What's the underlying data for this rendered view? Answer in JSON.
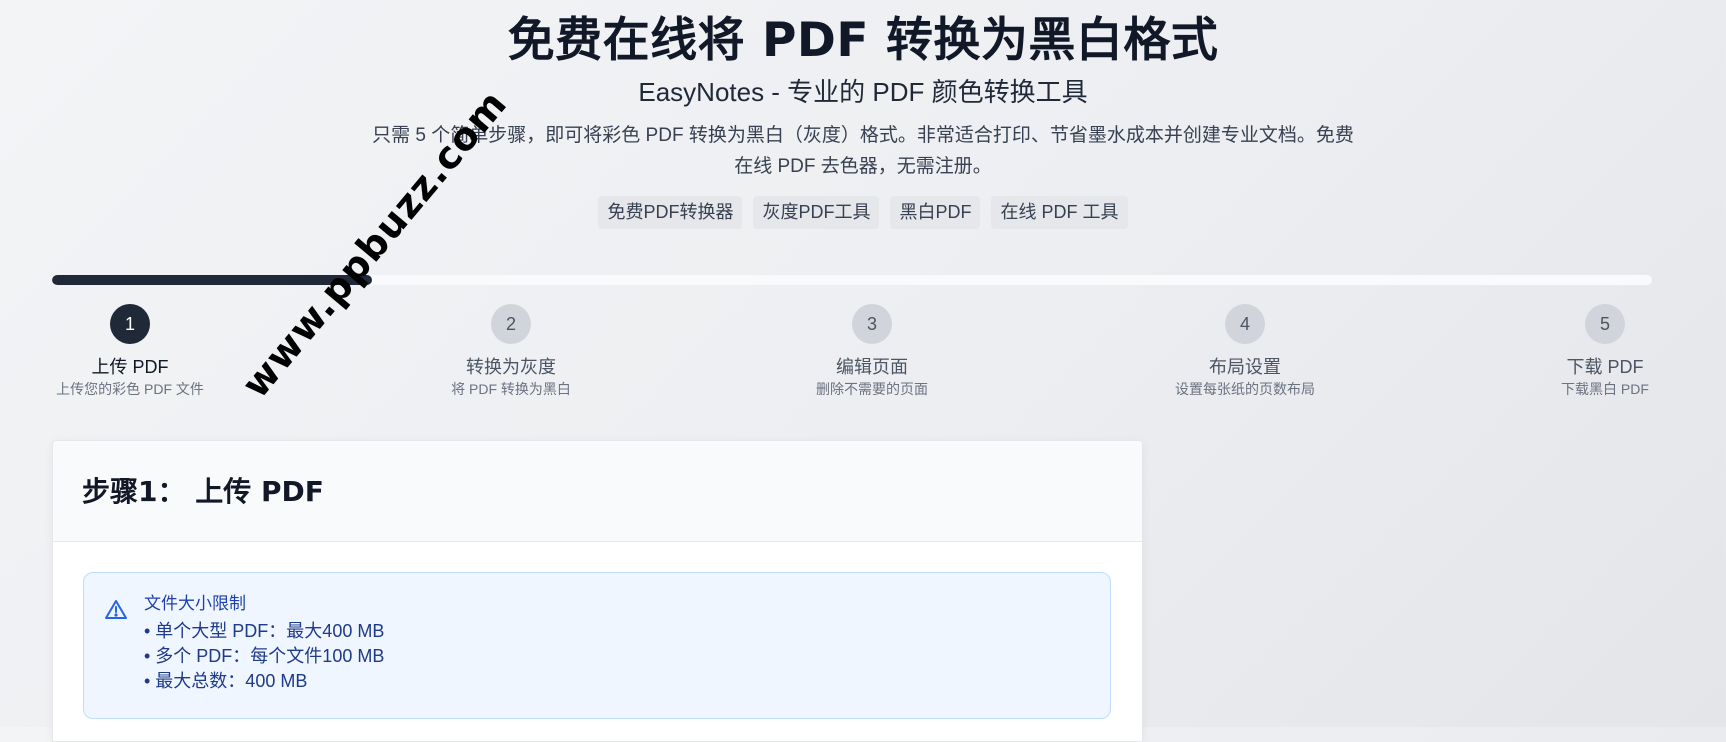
{
  "header": {
    "title": "免费在线将 PDF 转换为黑白格式",
    "subtitle": "EasyNotes - 专业的 PDF 颜色转换工具",
    "description": "只需 5 个简单步骤，即可将彩色 PDF 转换为黑白（灰度）格式。非常适合打印、节省墨水成本并创建专业文档。免费在线 PDF 去色器，无需注册。",
    "tags": [
      "免费PDF转换器",
      "灰度PDF工具",
      "黑白PDF",
      "在线 PDF 工具"
    ]
  },
  "progress": {
    "percent": 20
  },
  "steps": [
    {
      "number": "1",
      "title": "上传 PDF",
      "desc": "上传您的彩色 PDF 文件",
      "active": true
    },
    {
      "number": "2",
      "title": "转换为灰度",
      "desc": "将 PDF 转换为黑白",
      "active": false
    },
    {
      "number": "3",
      "title": "编辑页面",
      "desc": "删除不需要的页面",
      "active": false
    },
    {
      "number": "4",
      "title": "布局设置",
      "desc": "设置每张纸的页数布局",
      "active": false
    },
    {
      "number": "5",
      "title": "下载 PDF",
      "desc": "下载黑白 PDF",
      "active": false
    }
  ],
  "card": {
    "heading": "步骤1： 上传 PDF",
    "notice": {
      "icon": "warning-triangle-icon",
      "title": "文件大小限制",
      "items": [
        "• 单个大型 PDF：最大400 MB",
        "• 多个 PDF：每个文件100 MB",
        "• 最大总数：400 MB"
      ]
    }
  },
  "watermark": "www.ppbuzz.com",
  "colors": {
    "primary": "#1f2937",
    "notice_bg": "#eff6ff",
    "notice_border": "#bfdbfe",
    "notice_text": "#1e3a8a"
  }
}
